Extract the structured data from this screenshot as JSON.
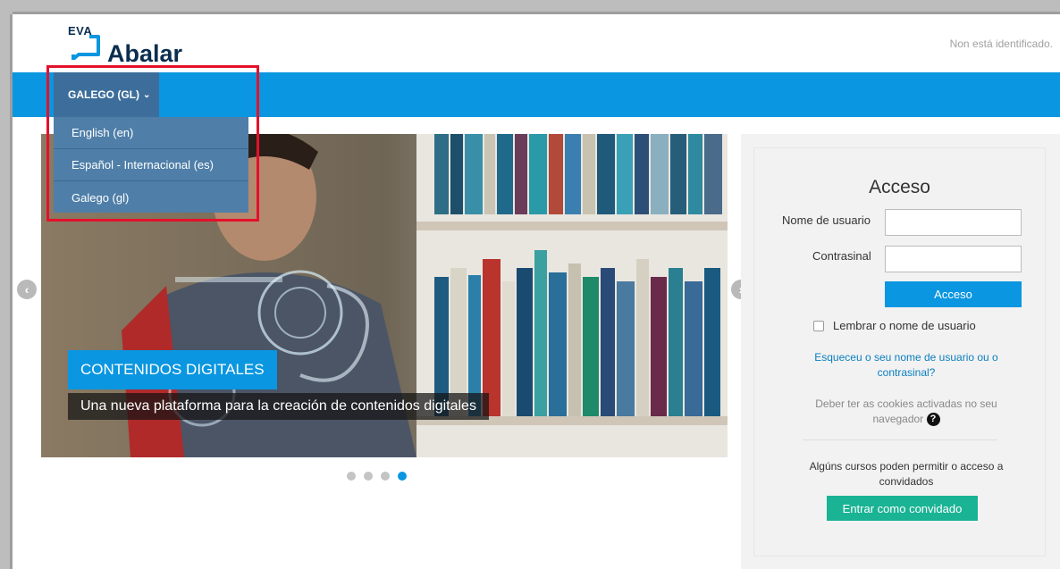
{
  "header": {
    "logo_small": "EVA",
    "logo_text": "Abalar",
    "login_status": "Non está identificado."
  },
  "navbar": {
    "language_toggle": "GALEGO (GL)",
    "language_menu": [
      "English (en)",
      "Español - Internacional (es)",
      "Galego (gl)"
    ]
  },
  "carousel": {
    "caption_title": "CONTENIDOS DIGITALES",
    "caption_subtitle": "Una nueva plataforma para la creación de contenidos digitales",
    "slide_count": 4,
    "active_slide": 4
  },
  "login": {
    "title": "Acceso",
    "username_label": "Nome de usuario",
    "password_label": "Contrasinal",
    "submit_label": "Acceso",
    "remember_label": "Lembrar o nome de usuario",
    "forgot_link": "Esqueceu o seu nome de usuario ou o contrasinal?",
    "cookies_text": "Deber ter as cookies activadas no seu navegador",
    "guest_text": "Algúns cursos poden permitir o acceso a convidados",
    "guest_button": "Entrar como convidado"
  },
  "colors": {
    "navbar": "#0a96e0",
    "dropdown": "#4f7fa8",
    "highlight_box": "#e5102b",
    "guest_button": "#1ab394"
  }
}
